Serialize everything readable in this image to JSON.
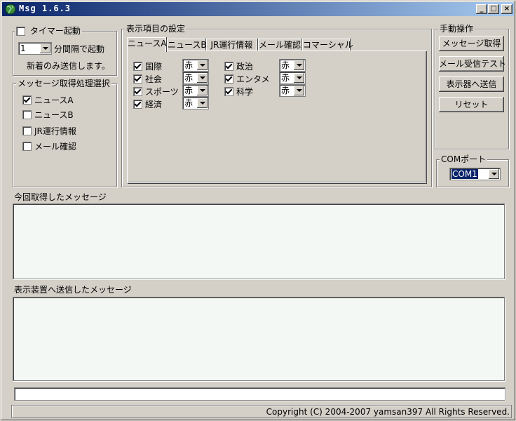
{
  "window": {
    "title": "Msg  1.6.3"
  },
  "titlebar_buttons": {
    "minimize": "_",
    "maximize": "□",
    "close": "×"
  },
  "timer": {
    "group_label": "タイマー起動",
    "checked": false,
    "interval_value": "1",
    "interval_suffix": "分間隔で起動",
    "note": "新着のみ送信します。"
  },
  "message_select": {
    "group_label": "メッセージ取得処理選択",
    "items": [
      {
        "label": "ニュースA",
        "checked": true
      },
      {
        "label": "ニュースB",
        "checked": false
      },
      {
        "label": "JR運行情報",
        "checked": false
      },
      {
        "label": "メール確認",
        "checked": false
      }
    ]
  },
  "display_settings": {
    "group_label": "表示項目の設定",
    "tabs": [
      "ニュースA",
      "ニュースB",
      "JR運行情報",
      "メール確認",
      "コマーシャル"
    ],
    "active_tab": "ニュースA",
    "left_items": [
      {
        "label": "国際",
        "checked": true,
        "color": "赤"
      },
      {
        "label": "社会",
        "checked": true,
        "color": "赤"
      },
      {
        "label": "スポーツ",
        "checked": true,
        "color": "赤"
      },
      {
        "label": "経済",
        "checked": true,
        "color": "赤"
      }
    ],
    "right_items": [
      {
        "label": "政治",
        "checked": true,
        "color": "赤"
      },
      {
        "label": "エンタメ",
        "checked": true,
        "color": "赤"
      },
      {
        "label": "科学",
        "checked": true,
        "color": "赤"
      }
    ]
  },
  "manual": {
    "group_label": "手動操作",
    "buttons": [
      "メッセージ取得",
      "メール受信テスト",
      "表示器へ送信",
      "リセット"
    ]
  },
  "com_port": {
    "group_label": "COMポート",
    "value": "COM1"
  },
  "received": {
    "label": "今回取得したメッセージ",
    "content": ""
  },
  "sent": {
    "label": "表示装置へ送信したメッセージ",
    "content": ""
  },
  "status": {
    "input_value": "",
    "copyright": "Copyright (C) 2004-2007 yamsan397 All Rights Reserved."
  },
  "colors": {
    "titlebar_start": "#0a246a",
    "titlebar_end": "#a6caf0",
    "face": "#d4d0c8",
    "textarea_bg": "#f4f8f4",
    "selection": "#0a246a"
  }
}
